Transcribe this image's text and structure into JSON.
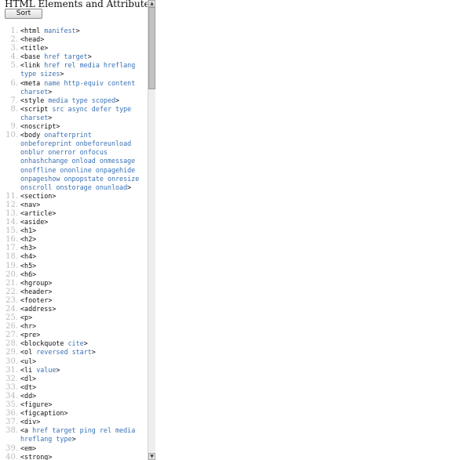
{
  "title": "HTML Elements and Attributes",
  "sort_label": "Sort",
  "colors": {
    "tag": "#111111",
    "attribute": "#3a72b5",
    "line_number": "#bbbbbb"
  },
  "icons": {
    "scroll_up": "arrow-up-icon",
    "scroll_down": "arrow-down-icon"
  },
  "items": [
    {
      "n": "1.",
      "tag": "html",
      "attrs": "manifest"
    },
    {
      "n": "2.",
      "tag": "head",
      "attrs": ""
    },
    {
      "n": "3.",
      "tag": "title",
      "attrs": ""
    },
    {
      "n": "4.",
      "tag": "base",
      "attrs": "href target"
    },
    {
      "n": "5.",
      "tag": "link",
      "attrs": "href rel media hreflang type sizes"
    },
    {
      "n": "6.",
      "tag": "meta",
      "attrs": "name http-equiv content charset"
    },
    {
      "n": "7.",
      "tag": "style",
      "attrs": "media type scoped"
    },
    {
      "n": "8.",
      "tag": "script",
      "attrs": "src async defer type charset"
    },
    {
      "n": "9.",
      "tag": "noscript",
      "attrs": ""
    },
    {
      "n": "10.",
      "tag": "body",
      "attrs": "onafterprint onbeforeprint onbeforeunload onblur onerror onfocus onhashchange onload onmessage onoffline ononline onpagehide onpageshow onpopstate onresize onscroll onstorage onunload"
    },
    {
      "n": "11.",
      "tag": "section",
      "attrs": ""
    },
    {
      "n": "12.",
      "tag": "nav",
      "attrs": ""
    },
    {
      "n": "13.",
      "tag": "article",
      "attrs": ""
    },
    {
      "n": "14.",
      "tag": "aside",
      "attrs": ""
    },
    {
      "n": "15.",
      "tag": "h1",
      "attrs": ""
    },
    {
      "n": "16.",
      "tag": "h2",
      "attrs": ""
    },
    {
      "n": "17.",
      "tag": "h3",
      "attrs": ""
    },
    {
      "n": "18.",
      "tag": "h4",
      "attrs": ""
    },
    {
      "n": "19.",
      "tag": "h5",
      "attrs": ""
    },
    {
      "n": "20.",
      "tag": "h6",
      "attrs": ""
    },
    {
      "n": "21.",
      "tag": "hgroup",
      "attrs": ""
    },
    {
      "n": "22.",
      "tag": "header",
      "attrs": ""
    },
    {
      "n": "23.",
      "tag": "footer",
      "attrs": ""
    },
    {
      "n": "24.",
      "tag": "address",
      "attrs": ""
    },
    {
      "n": "25.",
      "tag": "p",
      "attrs": ""
    },
    {
      "n": "26.",
      "tag": "hr",
      "attrs": ""
    },
    {
      "n": "27.",
      "tag": "pre",
      "attrs": ""
    },
    {
      "n": "28.",
      "tag": "blockquote",
      "attrs": "cite"
    },
    {
      "n": "29.",
      "tag": "ol",
      "attrs": "reversed start"
    },
    {
      "n": "30.",
      "tag": "ul",
      "attrs": ""
    },
    {
      "n": "31.",
      "tag": "li",
      "attrs": "value"
    },
    {
      "n": "32.",
      "tag": "dl",
      "attrs": ""
    },
    {
      "n": "33.",
      "tag": "dt",
      "attrs": ""
    },
    {
      "n": "34.",
      "tag": "dd",
      "attrs": ""
    },
    {
      "n": "35.",
      "tag": "figure",
      "attrs": ""
    },
    {
      "n": "36.",
      "tag": "figcaption",
      "attrs": ""
    },
    {
      "n": "37.",
      "tag": "div",
      "attrs": ""
    },
    {
      "n": "38.",
      "tag": "a",
      "attrs": "href target ping rel media hreflang type"
    },
    {
      "n": "39.",
      "tag": "em",
      "attrs": ""
    },
    {
      "n": "40.",
      "tag": "strong",
      "attrs": ""
    }
  ]
}
